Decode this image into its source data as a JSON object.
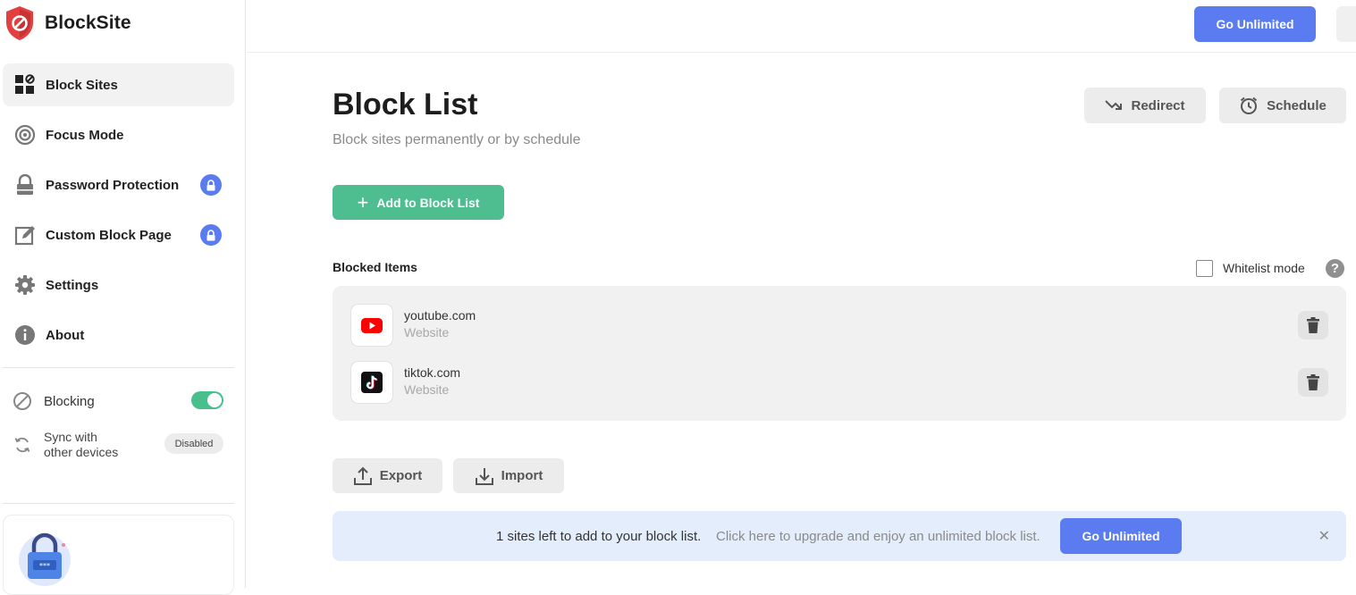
{
  "app": {
    "name": "BlockSite"
  },
  "sidebar": {
    "items": [
      {
        "label": "Block Sites",
        "icon": "block-sites-icon",
        "active": true,
        "locked": false
      },
      {
        "label": "Focus Mode",
        "icon": "focus-target-icon",
        "active": false,
        "locked": false
      },
      {
        "label": "Password Protection",
        "icon": "padlock-icon",
        "active": false,
        "locked": true
      },
      {
        "label": "Custom Block Page",
        "icon": "edit-page-icon",
        "active": false,
        "locked": true
      },
      {
        "label": "Settings",
        "icon": "gear-icon",
        "active": false,
        "locked": false
      },
      {
        "label": "About",
        "icon": "info-icon",
        "active": false,
        "locked": false
      }
    ],
    "blocking": {
      "label": "Blocking",
      "enabled": true
    },
    "sync": {
      "label_line1": "Sync with",
      "label_line2": "other devices",
      "status": "Disabled"
    }
  },
  "topbar": {
    "cta_label": "Go Unlimited"
  },
  "main": {
    "title": "Block List",
    "subtitle": "Block sites permanently or by schedule",
    "redirect_label": "Redirect",
    "schedule_label": "Schedule",
    "add_label": "Add to Block List",
    "section_label": "Blocked Items",
    "whitelist_label": "Whitelist mode",
    "whitelist_checked": false,
    "help_glyph": "?",
    "blocked_items": [
      {
        "domain": "youtube.com",
        "type": "Website",
        "icon": "youtube-icon"
      },
      {
        "domain": "tiktok.com",
        "type": "Website",
        "icon": "tiktok-icon"
      }
    ],
    "export_label": "Export",
    "import_label": "Import"
  },
  "banner": {
    "main_text": "1 sites left to add to your block list.",
    "sub_text": "Click here to upgrade and enjoy an unlimited block list.",
    "cta_label": "Go Unlimited",
    "close_glyph": "✕"
  },
  "colors": {
    "accent_blue": "#5b7cf0",
    "accent_green": "#4ebd8f",
    "brand_red": "#e2403f",
    "banner_bg": "#e4edfb"
  }
}
